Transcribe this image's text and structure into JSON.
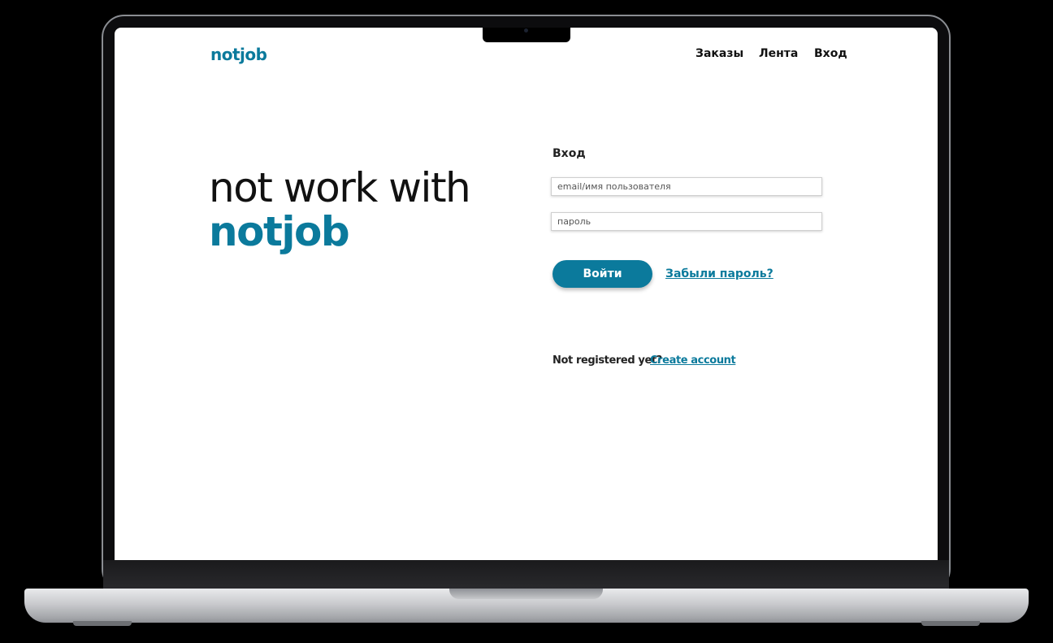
{
  "header": {
    "logo": "notjob",
    "nav": [
      "Заказы",
      "Лента",
      "Вход"
    ]
  },
  "hero": {
    "line1": "not work with",
    "line2": "notjob"
  },
  "login": {
    "title": "Вход",
    "email_placeholder": "email/имя пользователя",
    "password_placeholder": "пароль",
    "submit_label": "Войти",
    "forgot_label": "Забыли пароль?",
    "not_registered": "Not registered yet?",
    "create_account": "Create account"
  },
  "colors": {
    "accent": "#0b7a9c",
    "text": "#111111"
  }
}
